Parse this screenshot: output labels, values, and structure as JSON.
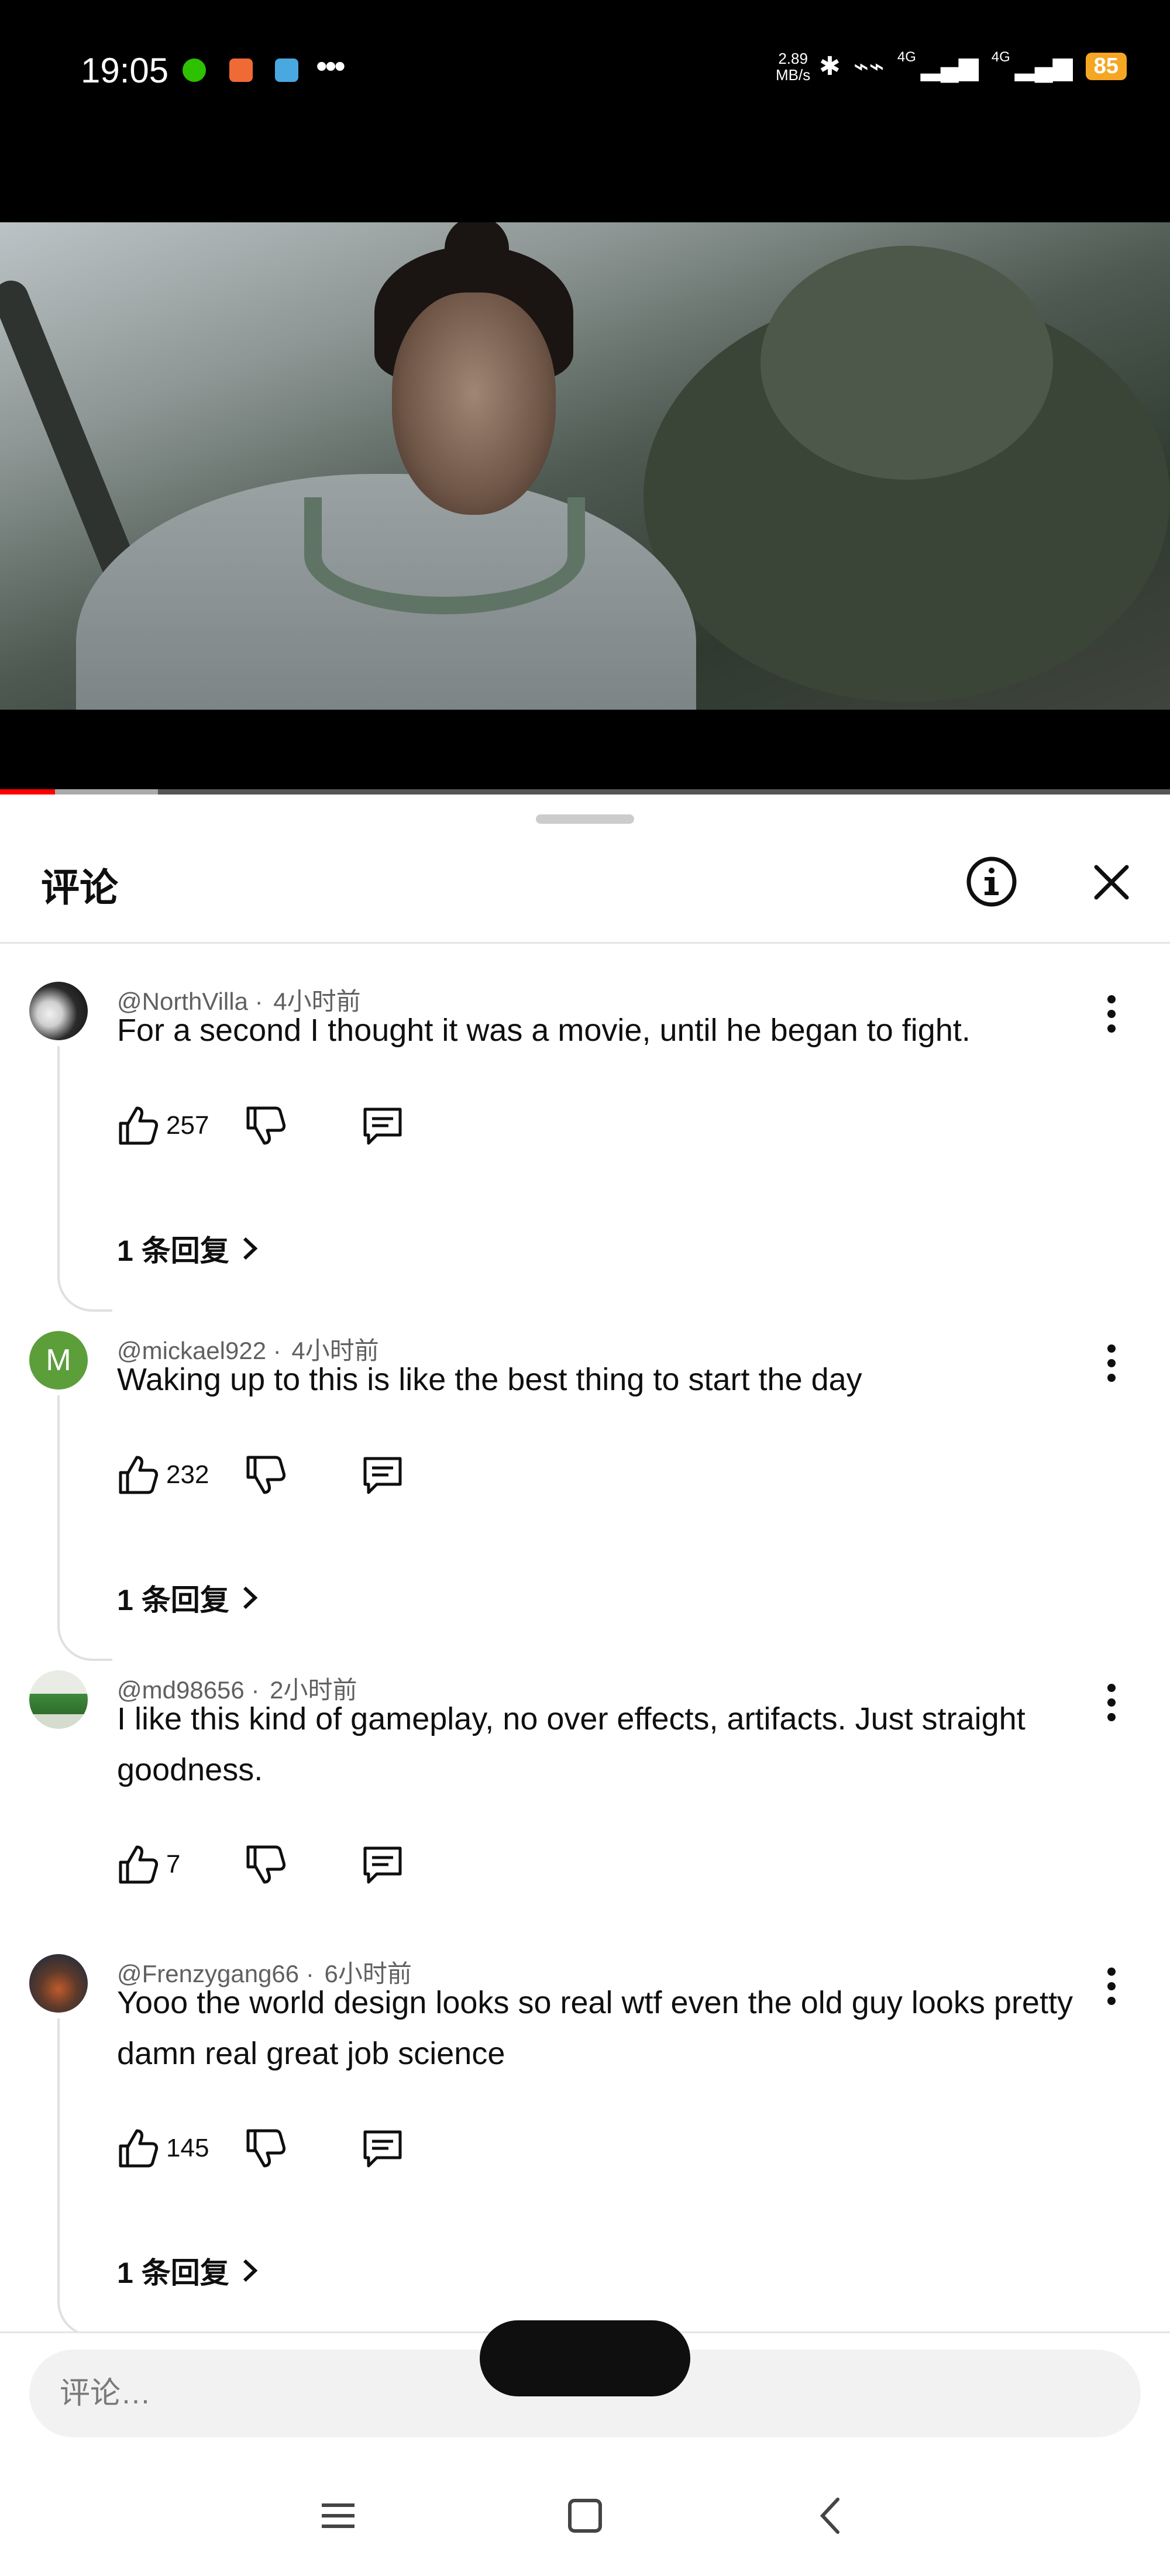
{
  "status_bar": {
    "time": "19:05",
    "speed_value": "2.89",
    "speed_unit": "MB/s",
    "network_1": "4G",
    "network_2": "4G",
    "battery": "85"
  },
  "sheet": {
    "title": "评论"
  },
  "comments": [
    {
      "author": "@NorthVilla",
      "time": "4小时前",
      "text": "For a second I thought it was a movie, until he began to fight.",
      "likes": "257",
      "replies": "1 条回复"
    },
    {
      "author": "@mickael922",
      "time": "4小时前",
      "avatar_letter": "M",
      "text": "Waking up to this is like the best thing to start the day",
      "likes": "232",
      "replies": "1 条回复"
    },
    {
      "author": "@md98656",
      "time": "2小时前",
      "text": "I like this kind of gameplay, no over effects, artifacts. Just straight goodness.",
      "likes": "7"
    },
    {
      "author": "@Frenzygang66",
      "time": "6小时前",
      "text": "Yooo the world design looks so real wtf even the old guy looks pretty damn real great job science",
      "likes": "145",
      "replies": "1 条回复"
    }
  ],
  "input": {
    "placeholder": "评论…"
  },
  "colors": {
    "battery": "#f5a623",
    "progress": "#ff0000",
    "avatar_green": "#5c9e3a"
  }
}
